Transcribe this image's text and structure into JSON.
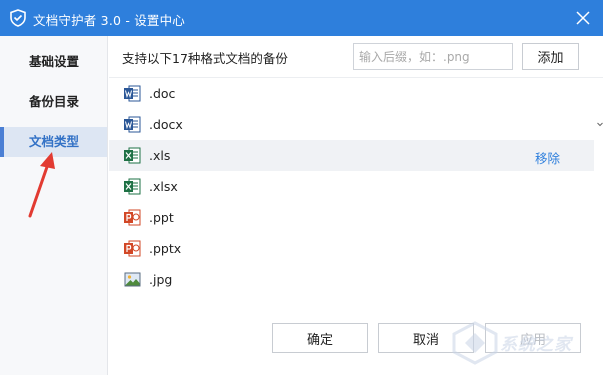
{
  "window": {
    "title": "文档守护者 3.0 - 设置中心",
    "accent": "#2e7fdc",
    "logo_icon": "shield-icon",
    "close_icon": "close-icon"
  },
  "sidebar": {
    "items": [
      {
        "label": "基础设置",
        "active": false
      },
      {
        "label": "备份目录",
        "active": false
      },
      {
        "label": "文档类型",
        "active": true
      }
    ]
  },
  "main": {
    "description": "支持以下17种格式文档的备份",
    "extension_input": {
      "value": "",
      "placeholder": "输入后缀，如：.png"
    },
    "add_label": "添加",
    "file_types": [
      {
        "ext": ".doc",
        "icon": "word-icon"
      },
      {
        "ext": ".docx",
        "icon": "word-icon"
      },
      {
        "ext": ".xls",
        "icon": "excel-icon",
        "hovered": true
      },
      {
        "ext": ".xlsx",
        "icon": "excel-icon"
      },
      {
        "ext": ".ppt",
        "icon": "powerpoint-icon"
      },
      {
        "ext": ".pptx",
        "icon": "powerpoint-icon"
      },
      {
        "ext": ".jpg",
        "icon": "image-icon"
      }
    ],
    "remove_label": "移除"
  },
  "footer": {
    "ok_label": "确定",
    "cancel_label": "取消",
    "apply_label": "应用"
  },
  "watermark": {
    "text": "系统之家"
  }
}
